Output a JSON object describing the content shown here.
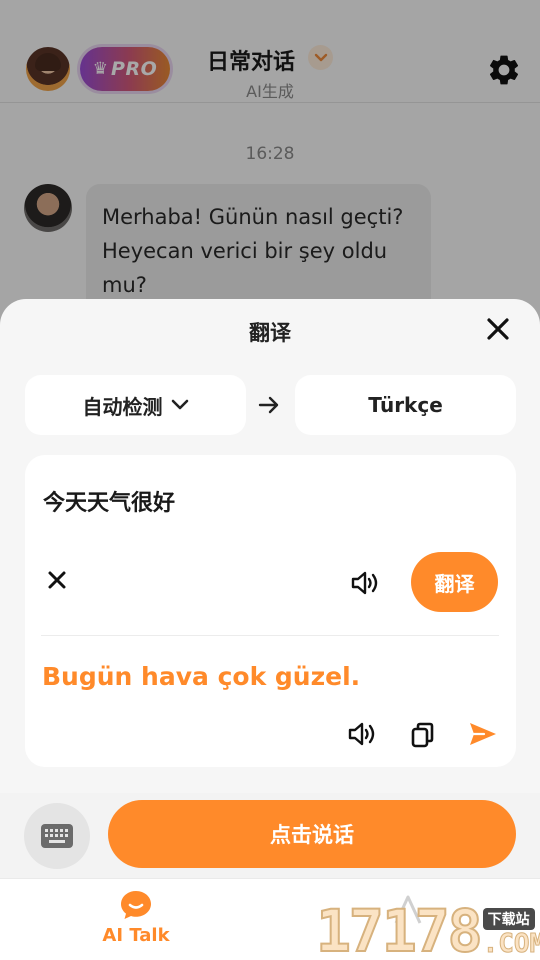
{
  "header": {
    "pro_label": "PRO",
    "title": "日常对话",
    "subtitle": "AI生成"
  },
  "chat": {
    "timestamp": "16:28",
    "messages": [
      {
        "sender": "bot",
        "text": "Merhaba! Günün nasıl geçti? Heyecan verici bir şey oldu mu?"
      }
    ]
  },
  "translate_sheet": {
    "title": "翻译",
    "source_language": "自动检测",
    "target_language": "Türkçe",
    "source_text": "今天天气很好",
    "translate_button": "翻译",
    "result_text": "Bugün hava çok güzel."
  },
  "input_bar": {
    "speak_button": "点击说话"
  },
  "bottom_nav": {
    "items": [
      {
        "label": "AI Talk",
        "active": true,
        "icon": "chat-bubble-icon"
      }
    ]
  },
  "watermark": {
    "number": "17178",
    "tag": "下载站",
    "domain": ".COM"
  },
  "colors": {
    "accent": "#ff8a2a",
    "sheet_background": "#f6f6f6",
    "card_background": "#ffffff"
  }
}
